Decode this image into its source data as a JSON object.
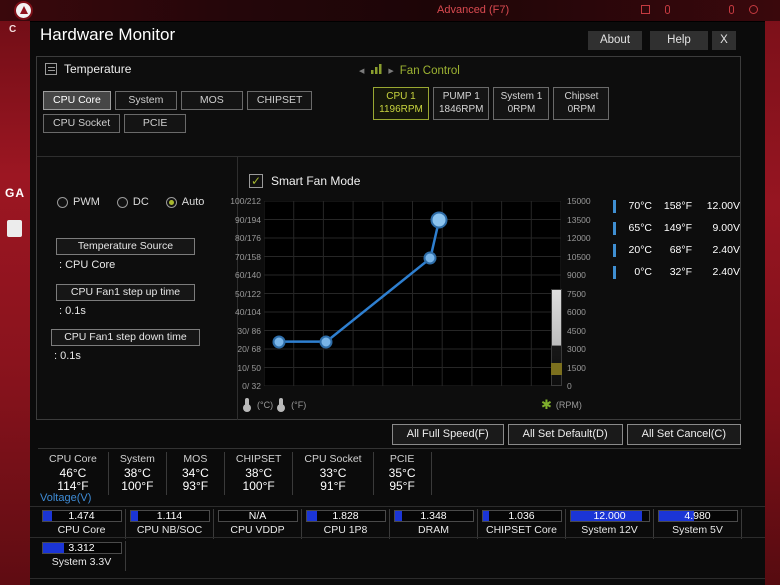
{
  "colors": {
    "accent_olive": "#a7b637",
    "accent_blue": "#2e7fd0",
    "bar_blue": "#1b35d6",
    "brand_red": "#8f131d"
  },
  "topbar": {
    "advanced_label": "Advanced (F7)"
  },
  "window": {
    "title": "Hardware Monitor",
    "about_label": "About",
    "help_label": "Help",
    "close_label": "X"
  },
  "temperature_section": {
    "label": "Temperature",
    "selected_tab": "CPU Core",
    "tabs_row1": [
      "CPU Core",
      "System",
      "MOS",
      "CHIPSET"
    ],
    "tabs_row2": [
      "CPU Socket",
      "PCIE"
    ]
  },
  "fan_control": {
    "label": "Fan Control",
    "fans": [
      {
        "name": "CPU 1",
        "rpm": "1196RPM",
        "selected": true
      },
      {
        "name": "PUMP 1",
        "rpm": "1846RPM",
        "selected": false
      },
      {
        "name": "System 1",
        "rpm": "0RPM",
        "selected": false
      },
      {
        "name": "Chipset",
        "rpm": "0RPM",
        "selected": false
      }
    ]
  },
  "mode_controls": {
    "options": [
      "PWM",
      "DC",
      "Auto"
    ],
    "selected": "Auto"
  },
  "settings": {
    "temperature_source": {
      "label": "Temperature Source",
      "value": ": CPU Core"
    },
    "step_up": {
      "label": "CPU Fan1 step up time",
      "value": ": 0.1s"
    },
    "step_down": {
      "label": "CPU Fan1 step down time",
      "value": ": 0.1s"
    }
  },
  "smart_fan": {
    "label": "Smart Fan Mode",
    "checked": true
  },
  "chart_data": {
    "type": "line",
    "title": "Smart Fan Mode",
    "y_axis_temp_labels": [
      "100/212",
      "90/194",
      "80/176",
      "70/158",
      "60/140",
      "50/122",
      "40/104",
      "30/ 86",
      "20/ 68",
      "10/ 50",
      "0/ 32"
    ],
    "rpm_axis_labels": [
      "15000",
      "13500",
      "12000",
      "10500",
      "9000",
      "7500",
      "6000",
      "4500",
      "3000",
      "1500",
      "0"
    ],
    "x_unit_labels": [
      "(°C)",
      "(°F)"
    ],
    "rpm_unit_label": "(RPM)",
    "curve_setpoints": [
      {
        "temp_c": 0,
        "temp_f": 32,
        "voltage": 2.4
      },
      {
        "temp_c": 20,
        "temp_f": 68,
        "voltage": 2.4
      },
      {
        "temp_c": 65,
        "temp_f": 149,
        "voltage": 9.0
      },
      {
        "temp_c": 70,
        "temp_f": 158,
        "voltage": 12.0
      }
    ],
    "curve_points_pct": [
      {
        "x": 5,
        "y": 76
      },
      {
        "x": 21,
        "y": 76
      },
      {
        "x": 56,
        "y": 31
      },
      {
        "x": 59,
        "y": 10
      }
    ]
  },
  "legend": [
    {
      "temp_c": "70°C",
      "temp_f": "158°F",
      "voltage": "12.00V"
    },
    {
      "temp_c": "65°C",
      "temp_f": "149°F",
      "voltage": "9.00V"
    },
    {
      "temp_c": "20°C",
      "temp_f": "68°F",
      "voltage": "2.40V"
    },
    {
      "temp_c": "0°C",
      "temp_f": "32°F",
      "voltage": "2.40V"
    }
  ],
  "action_buttons": [
    "All Full Speed(F)",
    "All Set Default(D)",
    "All Set Cancel(C)"
  ],
  "temperatures": [
    {
      "name": "CPU Core",
      "celsius": "46°C",
      "fahrenheit": "114°F"
    },
    {
      "name": "System",
      "celsius": "38°C",
      "fahrenheit": "100°F"
    },
    {
      "name": "MOS",
      "celsius": "34°C",
      "fahrenheit": "93°F"
    },
    {
      "name": "CHIPSET",
      "celsius": "38°C",
      "fahrenheit": "100°F"
    },
    {
      "name": "CPU Socket",
      "celsius": "33°C",
      "fahrenheit": "91°F"
    },
    {
      "name": "PCIE",
      "celsius": "35°C",
      "fahrenheit": "95°F"
    }
  ],
  "voltage": {
    "section_label": "Voltage(V)",
    "row1": [
      {
        "name": "CPU Core",
        "value": "1.474",
        "fill_pct": 12
      },
      {
        "name": "CPU NB/SOC",
        "value": "1.114",
        "fill_pct": 9
      },
      {
        "name": "CPU VDDP",
        "value": "N/A",
        "fill_pct": 0
      },
      {
        "name": "CPU 1P8",
        "value": "1.828",
        "fill_pct": 14
      },
      {
        "name": "DRAM",
        "value": "1.348",
        "fill_pct": 10
      },
      {
        "name": "CHIPSET Core",
        "value": "1.036",
        "fill_pct": 8
      },
      {
        "name": "System 12V",
        "value": "12.000",
        "fill_pct": 92
      },
      {
        "name": "System 5V",
        "value": "4.980",
        "fill_pct": 45
      }
    ],
    "row2": [
      {
        "name": "System 3.3V",
        "value": "3.312",
        "fill_pct": 28
      }
    ]
  },
  "background_fragments": {
    "left_top": "C",
    "left_mid": "GA"
  }
}
